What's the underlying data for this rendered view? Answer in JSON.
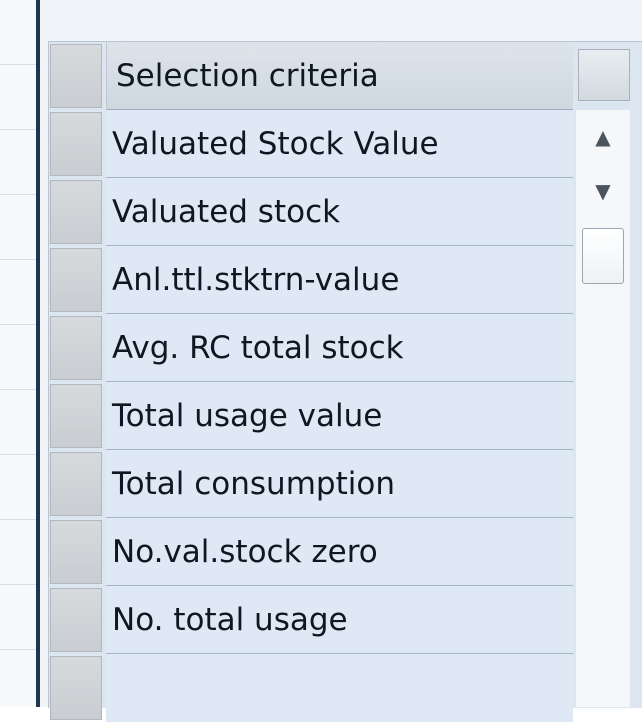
{
  "table": {
    "header": "Selection criteria",
    "rows": [
      "Valuated Stock Value",
      "Valuated stock",
      "Anl.ttl.stktrn-value",
      "Avg. RC total stock",
      "Total usage value",
      "Total consumption",
      "No.val.stock zero",
      "No. total usage"
    ]
  },
  "scrollbar": {
    "up_icon": "▲",
    "down_icon": "▼"
  },
  "colors": {
    "frame": "#1f3550",
    "cell": "#dfe9f5",
    "selector": "#c9cdd1"
  }
}
